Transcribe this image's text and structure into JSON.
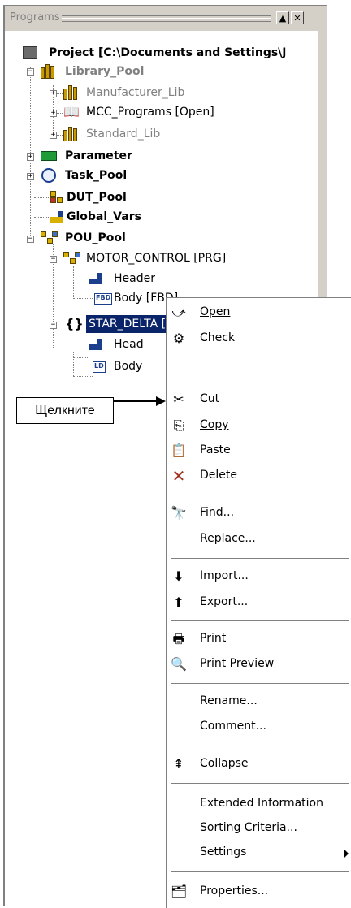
{
  "panel": {
    "title": "Programs",
    "btn_min": "▲",
    "btn_close": "✕"
  },
  "tree": {
    "project": "Project [C:\\Documents and Settings\\J",
    "library_pool": "Library_Pool",
    "manufacturer_lib": "Manufacturer_Lib",
    "mcc_programs": "MCC_Programs [Open]",
    "standard_lib": "Standard_Lib",
    "parameter": "Parameter",
    "task_pool": "Task_Pool",
    "dut_pool": "DUT_Pool",
    "global_vars": "Global_Vars",
    "pou_pool": "POU_Pool",
    "motor_control": "MOTOR_CONTROL [PRG]",
    "header": "Header",
    "body_fbd": "Body [FBD]",
    "fbd_tag": "FBD",
    "star_delta": "STAR_DELTA [FB]",
    "header2": "Head",
    "body2": "Body",
    "ld_tag": "LD"
  },
  "menu": {
    "open": "Open",
    "check": "Check",
    "cut": "Cut",
    "copy": "Copy",
    "paste": "Paste",
    "delete": "Delete",
    "find": "Find...",
    "replace": "Replace...",
    "import": "Import...",
    "export": "Export...",
    "print": "Print",
    "print_preview": "Print Preview",
    "rename": "Rename...",
    "comment": "Comment...",
    "collapse": "Collapse",
    "extended_information": "Extended Information",
    "sorting_criteria": "Sorting Criteria...",
    "settings": "Settings",
    "properties": "Properties..."
  },
  "callout": {
    "text": "Щелкните"
  },
  "colors": {
    "selection": "#0a246a",
    "panel_face": "#d4d0c8",
    "disabled_text": "#808080"
  }
}
